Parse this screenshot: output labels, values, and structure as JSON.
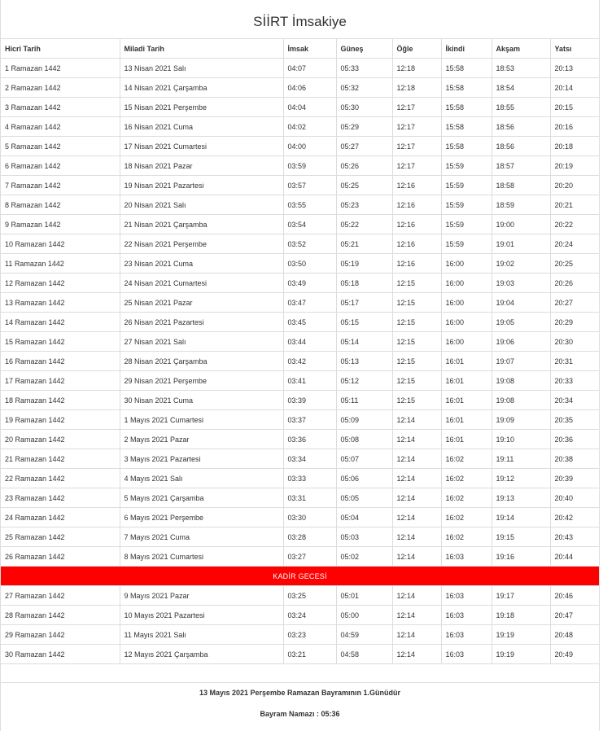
{
  "title": "SİİRT İmsakiye",
  "headers": [
    "Hicri Tarih",
    "Miladi Tarih",
    "İmsak",
    "Güneş",
    "Öğle",
    "İkindi",
    "Akşam",
    "Yatsı"
  ],
  "rows_before": [
    [
      "1 Ramazan 1442",
      "13 Nisan 2021 Salı",
      "04:07",
      "05:33",
      "12:18",
      "15:58",
      "18:53",
      "20:13"
    ],
    [
      "2 Ramazan 1442",
      "14 Nisan 2021 Çarşamba",
      "04:06",
      "05:32",
      "12:18",
      "15:58",
      "18:54",
      "20:14"
    ],
    [
      "3 Ramazan 1442",
      "15 Nisan 2021 Perşembe",
      "04:04",
      "05:30",
      "12:17",
      "15:58",
      "18:55",
      "20:15"
    ],
    [
      "4 Ramazan 1442",
      "16 Nisan 2021 Cuma",
      "04:02",
      "05:29",
      "12:17",
      "15:58",
      "18:56",
      "20:16"
    ],
    [
      "5 Ramazan 1442",
      "17 Nisan 2021 Cumartesi",
      "04:00",
      "05:27",
      "12:17",
      "15:58",
      "18:56",
      "20:18"
    ],
    [
      "6 Ramazan 1442",
      "18 Nisan 2021 Pazar",
      "03:59",
      "05:26",
      "12:17",
      "15:59",
      "18:57",
      "20:19"
    ],
    [
      "7 Ramazan 1442",
      "19 Nisan 2021 Pazartesi",
      "03:57",
      "05:25",
      "12:16",
      "15:59",
      "18:58",
      "20:20"
    ],
    [
      "8 Ramazan 1442",
      "20 Nisan 2021 Salı",
      "03:55",
      "05:23",
      "12:16",
      "15:59",
      "18:59",
      "20:21"
    ],
    [
      "9 Ramazan 1442",
      "21 Nisan 2021 Çarşamba",
      "03:54",
      "05:22",
      "12:16",
      "15:59",
      "19:00",
      "20:22"
    ],
    [
      "10 Ramazan 1442",
      "22 Nisan 2021 Perşembe",
      "03:52",
      "05:21",
      "12:16",
      "15:59",
      "19:01",
      "20:24"
    ],
    [
      "11 Ramazan 1442",
      "23 Nisan 2021 Cuma",
      "03:50",
      "05:19",
      "12:16",
      "16:00",
      "19:02",
      "20:25"
    ],
    [
      "12 Ramazan 1442",
      "24 Nisan 2021 Cumartesi",
      "03:49",
      "05:18",
      "12:15",
      "16:00",
      "19:03",
      "20:26"
    ],
    [
      "13 Ramazan 1442",
      "25 Nisan 2021 Pazar",
      "03:47",
      "05:17",
      "12:15",
      "16:00",
      "19:04",
      "20:27"
    ],
    [
      "14 Ramazan 1442",
      "26 Nisan 2021 Pazartesi",
      "03:45",
      "05:15",
      "12:15",
      "16:00",
      "19:05",
      "20:29"
    ],
    [
      "15 Ramazan 1442",
      "27 Nisan 2021 Salı",
      "03:44",
      "05:14",
      "12:15",
      "16:00",
      "19:06",
      "20:30"
    ],
    [
      "16 Ramazan 1442",
      "28 Nisan 2021 Çarşamba",
      "03:42",
      "05:13",
      "12:15",
      "16:01",
      "19:07",
      "20:31"
    ],
    [
      "17 Ramazan 1442",
      "29 Nisan 2021 Perşembe",
      "03:41",
      "05:12",
      "12:15",
      "16:01",
      "19:08",
      "20:33"
    ],
    [
      "18 Ramazan 1442",
      "30 Nisan 2021 Cuma",
      "03:39",
      "05:11",
      "12:15",
      "16:01",
      "19:08",
      "20:34"
    ],
    [
      "19 Ramazan 1442",
      "1 Mayıs 2021 Cumartesi",
      "03:37",
      "05:09",
      "12:14",
      "16:01",
      "19:09",
      "20:35"
    ],
    [
      "20 Ramazan 1442",
      "2 Mayıs 2021 Pazar",
      "03:36",
      "05:08",
      "12:14",
      "16:01",
      "19:10",
      "20:36"
    ],
    [
      "21 Ramazan 1442",
      "3 Mayıs 2021 Pazartesi",
      "03:34",
      "05:07",
      "12:14",
      "16:02",
      "19:11",
      "20:38"
    ],
    [
      "22 Ramazan 1442",
      "4 Mayıs 2021 Salı",
      "03:33",
      "05:06",
      "12:14",
      "16:02",
      "19:12",
      "20:39"
    ],
    [
      "23 Ramazan 1442",
      "5 Mayıs 2021 Çarşamba",
      "03:31",
      "05:05",
      "12:14",
      "16:02",
      "19:13",
      "20:40"
    ],
    [
      "24 Ramazan 1442",
      "6 Mayıs 2021 Perşembe",
      "03:30",
      "05:04",
      "12:14",
      "16:02",
      "19:14",
      "20:42"
    ],
    [
      "25 Ramazan 1442",
      "7 Mayıs 2021 Cuma",
      "03:28",
      "05:03",
      "12:14",
      "16:02",
      "19:15",
      "20:43"
    ],
    [
      "26 Ramazan 1442",
      "8 Mayıs 2021 Cumartesi",
      "03:27",
      "05:02",
      "12:14",
      "16:03",
      "19:16",
      "20:44"
    ]
  ],
  "special_row": {
    "label": "KADİR GECESİ",
    "color": "#ff0000"
  },
  "rows_after": [
    [
      "27 Ramazan 1442",
      "9 Mayıs 2021 Pazar",
      "03:25",
      "05:01",
      "12:14",
      "16:03",
      "19:17",
      "20:46"
    ],
    [
      "28 Ramazan 1442",
      "10 Mayıs 2021 Pazartesi",
      "03:24",
      "05:00",
      "12:14",
      "16:03",
      "19:18",
      "20:47"
    ],
    [
      "29 Ramazan 1442",
      "11 Mayıs 2021 Salı",
      "03:23",
      "04:59",
      "12:14",
      "16:03",
      "19:19",
      "20:48"
    ],
    [
      "30 Ramazan 1442",
      "12 Mayıs 2021 Çarşamba",
      "03:21",
      "04:58",
      "12:14",
      "16:03",
      "19:19",
      "20:49"
    ]
  ],
  "footer": {
    "line1": "13 Mayıs 2021 Perşembe Ramazan Bayramının 1.Günüdür",
    "line2": "Bayram Namazı : 05:36"
  }
}
